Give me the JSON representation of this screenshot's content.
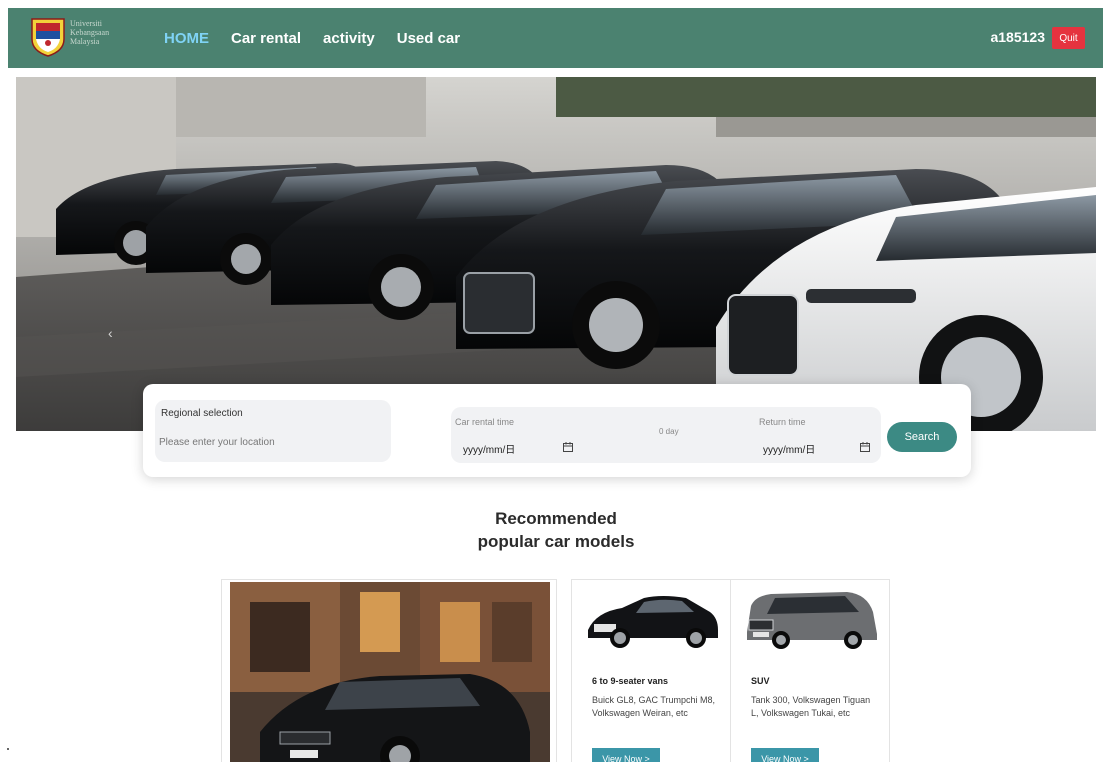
{
  "header": {
    "logo_text": "Universiti Kebangsaan Malaysia",
    "nav": [
      "HOME",
      "Car rental",
      "activity",
      "Used car"
    ],
    "active_nav": "HOME",
    "username": "a185123",
    "quit_label": "Quit"
  },
  "search": {
    "region_label": "Regional selection",
    "region_placeholder": "Please enter your location",
    "rental_time_label": "Car rental time",
    "rental_date_value": "yyyy/mm/日",
    "duration": "0 day",
    "return_time_label": "Return time",
    "return_date_value": "yyyy/mm/日",
    "search_label": "Search"
  },
  "recommended": {
    "title_line1": "Recommended",
    "title_line2": "popular car models",
    "cards": [
      {
        "title": "6 to 9-seater vans",
        "description": "Buick GL8, GAC Trumpchi M8, Volkswagen Weiran, etc",
        "button": "View Now >"
      },
      {
        "title": "SUV",
        "description": "Tank 300, Volkswagen Tiguan L, Volkswagen Tukai, etc",
        "button": "View Now >"
      }
    ]
  },
  "colors": {
    "header_bg": "#4b8270",
    "nav_active": "#7fd3f5",
    "quit_bg": "#e5333f",
    "search_button": "#3c8a84",
    "view_button": "#3b96a8"
  }
}
